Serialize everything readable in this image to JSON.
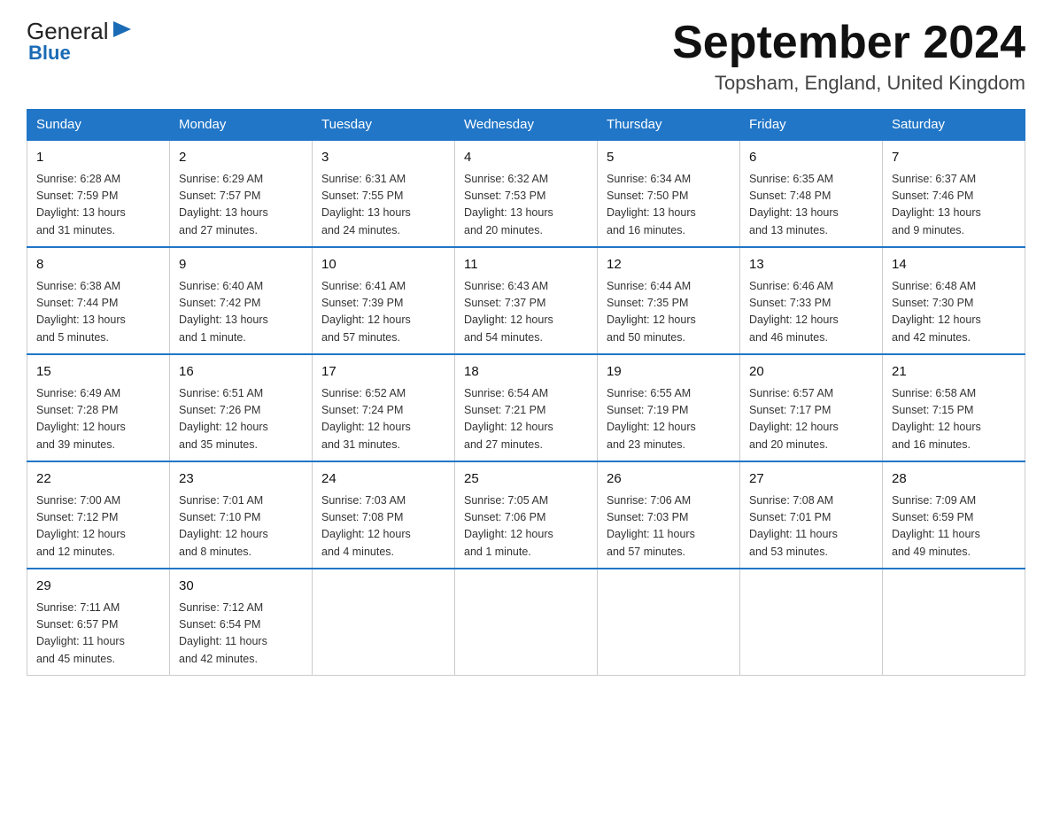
{
  "logo": {
    "general": "General",
    "blue": "Blue",
    "arrow": "▶"
  },
  "title": "September 2024",
  "location": "Topsham, England, United Kingdom",
  "weekdays": [
    "Sunday",
    "Monday",
    "Tuesday",
    "Wednesday",
    "Thursday",
    "Friday",
    "Saturday"
  ],
  "weeks": [
    [
      {
        "day": "1",
        "info": "Sunrise: 6:28 AM\nSunset: 7:59 PM\nDaylight: 13 hours\nand 31 minutes."
      },
      {
        "day": "2",
        "info": "Sunrise: 6:29 AM\nSunset: 7:57 PM\nDaylight: 13 hours\nand 27 minutes."
      },
      {
        "day": "3",
        "info": "Sunrise: 6:31 AM\nSunset: 7:55 PM\nDaylight: 13 hours\nand 24 minutes."
      },
      {
        "day": "4",
        "info": "Sunrise: 6:32 AM\nSunset: 7:53 PM\nDaylight: 13 hours\nand 20 minutes."
      },
      {
        "day": "5",
        "info": "Sunrise: 6:34 AM\nSunset: 7:50 PM\nDaylight: 13 hours\nand 16 minutes."
      },
      {
        "day": "6",
        "info": "Sunrise: 6:35 AM\nSunset: 7:48 PM\nDaylight: 13 hours\nand 13 minutes."
      },
      {
        "day": "7",
        "info": "Sunrise: 6:37 AM\nSunset: 7:46 PM\nDaylight: 13 hours\nand 9 minutes."
      }
    ],
    [
      {
        "day": "8",
        "info": "Sunrise: 6:38 AM\nSunset: 7:44 PM\nDaylight: 13 hours\nand 5 minutes."
      },
      {
        "day": "9",
        "info": "Sunrise: 6:40 AM\nSunset: 7:42 PM\nDaylight: 13 hours\nand 1 minute."
      },
      {
        "day": "10",
        "info": "Sunrise: 6:41 AM\nSunset: 7:39 PM\nDaylight: 12 hours\nand 57 minutes."
      },
      {
        "day": "11",
        "info": "Sunrise: 6:43 AM\nSunset: 7:37 PM\nDaylight: 12 hours\nand 54 minutes."
      },
      {
        "day": "12",
        "info": "Sunrise: 6:44 AM\nSunset: 7:35 PM\nDaylight: 12 hours\nand 50 minutes."
      },
      {
        "day": "13",
        "info": "Sunrise: 6:46 AM\nSunset: 7:33 PM\nDaylight: 12 hours\nand 46 minutes."
      },
      {
        "day": "14",
        "info": "Sunrise: 6:48 AM\nSunset: 7:30 PM\nDaylight: 12 hours\nand 42 minutes."
      }
    ],
    [
      {
        "day": "15",
        "info": "Sunrise: 6:49 AM\nSunset: 7:28 PM\nDaylight: 12 hours\nand 39 minutes."
      },
      {
        "day": "16",
        "info": "Sunrise: 6:51 AM\nSunset: 7:26 PM\nDaylight: 12 hours\nand 35 minutes."
      },
      {
        "day": "17",
        "info": "Sunrise: 6:52 AM\nSunset: 7:24 PM\nDaylight: 12 hours\nand 31 minutes."
      },
      {
        "day": "18",
        "info": "Sunrise: 6:54 AM\nSunset: 7:21 PM\nDaylight: 12 hours\nand 27 minutes."
      },
      {
        "day": "19",
        "info": "Sunrise: 6:55 AM\nSunset: 7:19 PM\nDaylight: 12 hours\nand 23 minutes."
      },
      {
        "day": "20",
        "info": "Sunrise: 6:57 AM\nSunset: 7:17 PM\nDaylight: 12 hours\nand 20 minutes."
      },
      {
        "day": "21",
        "info": "Sunrise: 6:58 AM\nSunset: 7:15 PM\nDaylight: 12 hours\nand 16 minutes."
      }
    ],
    [
      {
        "day": "22",
        "info": "Sunrise: 7:00 AM\nSunset: 7:12 PM\nDaylight: 12 hours\nand 12 minutes."
      },
      {
        "day": "23",
        "info": "Sunrise: 7:01 AM\nSunset: 7:10 PM\nDaylight: 12 hours\nand 8 minutes."
      },
      {
        "day": "24",
        "info": "Sunrise: 7:03 AM\nSunset: 7:08 PM\nDaylight: 12 hours\nand 4 minutes."
      },
      {
        "day": "25",
        "info": "Sunrise: 7:05 AM\nSunset: 7:06 PM\nDaylight: 12 hours\nand 1 minute."
      },
      {
        "day": "26",
        "info": "Sunrise: 7:06 AM\nSunset: 7:03 PM\nDaylight: 11 hours\nand 57 minutes."
      },
      {
        "day": "27",
        "info": "Sunrise: 7:08 AM\nSunset: 7:01 PM\nDaylight: 11 hours\nand 53 minutes."
      },
      {
        "day": "28",
        "info": "Sunrise: 7:09 AM\nSunset: 6:59 PM\nDaylight: 11 hours\nand 49 minutes."
      }
    ],
    [
      {
        "day": "29",
        "info": "Sunrise: 7:11 AM\nSunset: 6:57 PM\nDaylight: 11 hours\nand 45 minutes."
      },
      {
        "day": "30",
        "info": "Sunrise: 7:12 AM\nSunset: 6:54 PM\nDaylight: 11 hours\nand 42 minutes."
      },
      {
        "day": "",
        "info": ""
      },
      {
        "day": "",
        "info": ""
      },
      {
        "day": "",
        "info": ""
      },
      {
        "day": "",
        "info": ""
      },
      {
        "day": "",
        "info": ""
      }
    ]
  ]
}
